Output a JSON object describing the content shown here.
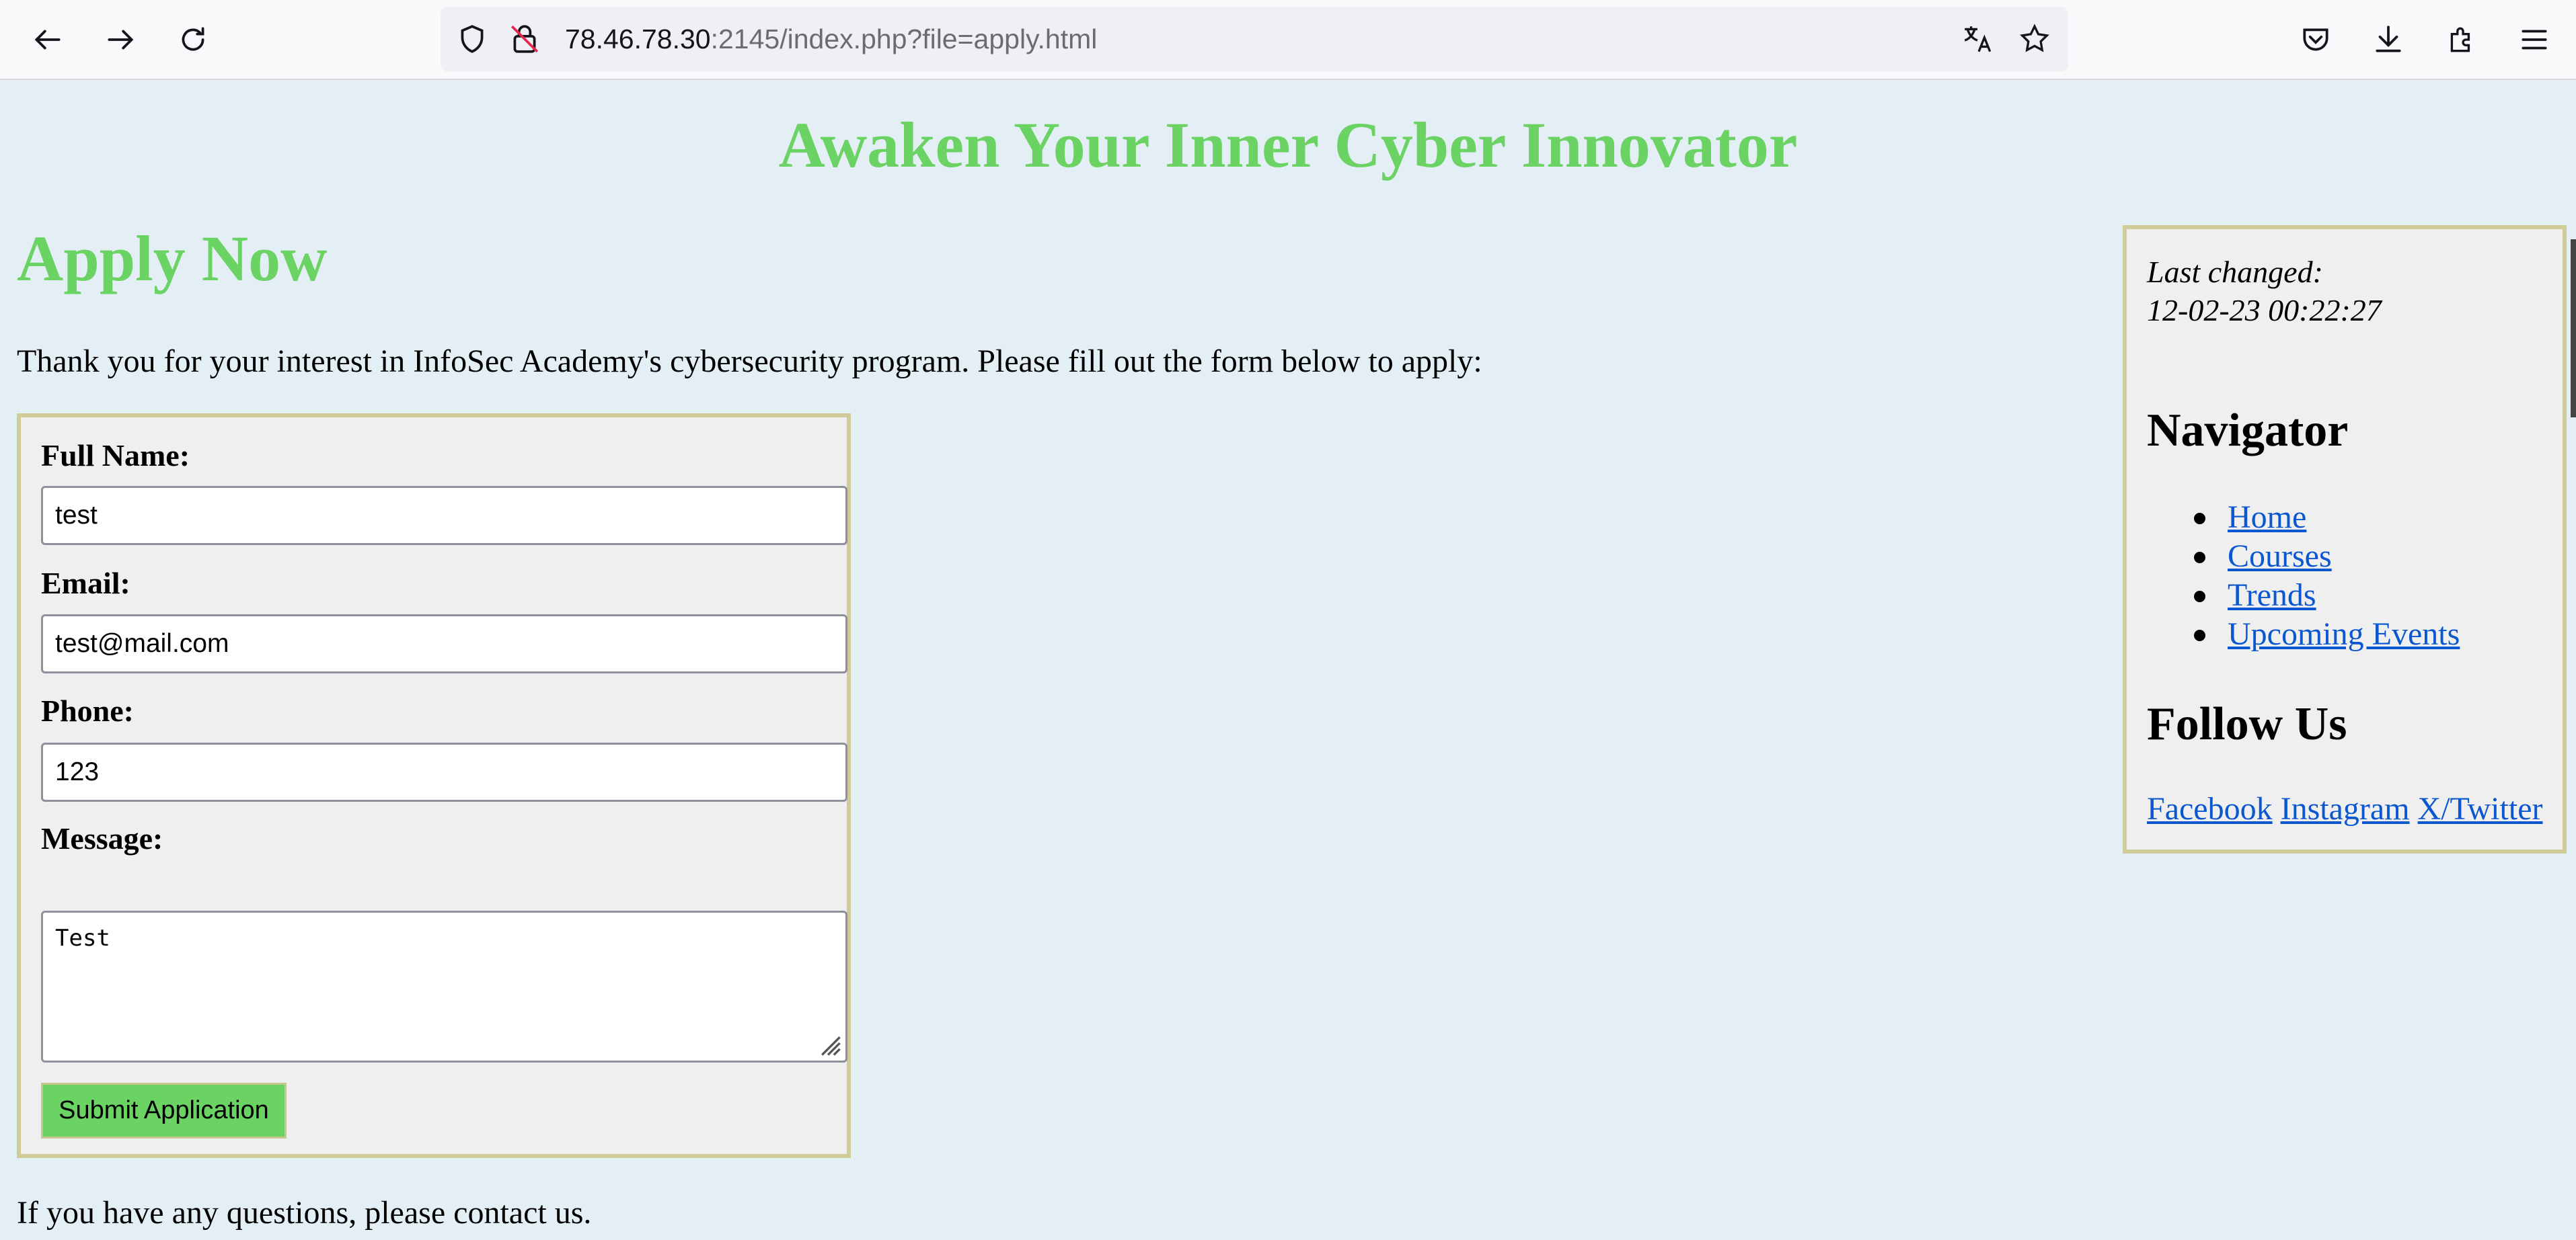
{
  "browser": {
    "url_host": "78.46.78.30",
    "url_rest": ":2145/index.php?file=apply.html"
  },
  "page": {
    "site_title": "Awaken Your Inner Cyber Innovator",
    "heading": "Apply Now",
    "intro": "Thank you for your interest in InfoSec Academy's cybersecurity program. Please fill out the form below to apply:",
    "contact": "If you have any questions, please contact us."
  },
  "form": {
    "name_label": "Full Name:",
    "name_value": "test",
    "email_label": "Email:",
    "email_value": "test@mail.com",
    "phone_label": "Phone:",
    "phone_value": "123",
    "message_label": "Message:",
    "message_value": "Test",
    "submit_label": "Submit Application"
  },
  "sidebar": {
    "last_changed_label": "Last changed:",
    "last_changed_value": "12-02-23 00:22:27",
    "nav_heading": "Navigator",
    "nav_items": [
      "Home",
      "Courses",
      "Trends",
      "Upcoming Events"
    ],
    "follow_heading": "Follow Us",
    "social": [
      "Facebook",
      "Instagram",
      "X/Twitter"
    ]
  },
  "colors": {
    "accent_green": "#6bd264",
    "page_bg": "#e4eff5",
    "link": "#0b57d0"
  }
}
